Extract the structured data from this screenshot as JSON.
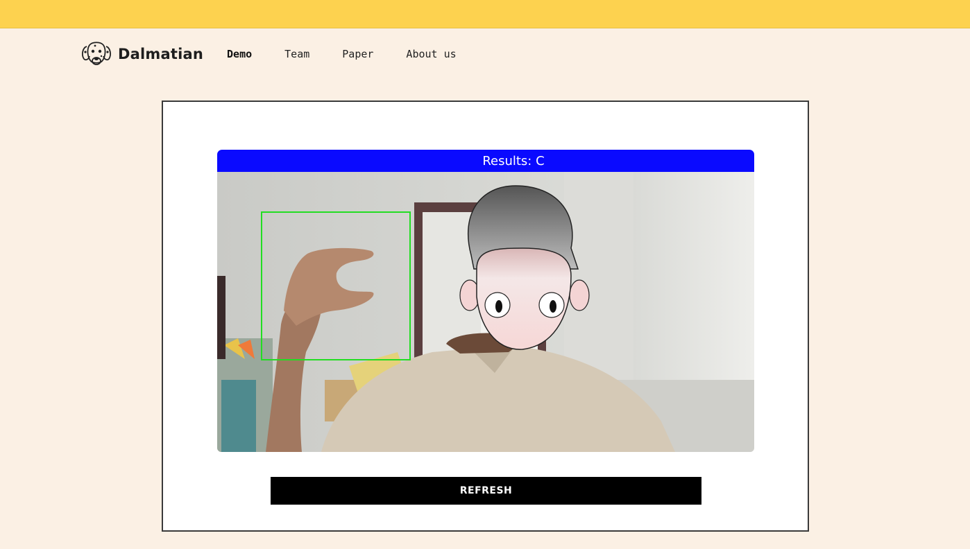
{
  "brand": {
    "name": "Dalmatian",
    "logo_icon": "dalmatian-dog-icon"
  },
  "nav": {
    "items": [
      {
        "label": "Demo",
        "active": true
      },
      {
        "label": "Team",
        "active": false
      },
      {
        "label": "Paper",
        "active": false
      },
      {
        "label": "About us",
        "active": false
      }
    ]
  },
  "demo": {
    "result_text": "Results: C",
    "refresh_label": "REFRESH",
    "camera_feed": "webcam-feed-with-hand-detection",
    "detection_box_color": "#22dd22"
  },
  "colors": {
    "top_strip": "#fdd24f",
    "page_background": "#fbf0e4",
    "result_bar": "#0a0aff",
    "button": "#000000"
  }
}
